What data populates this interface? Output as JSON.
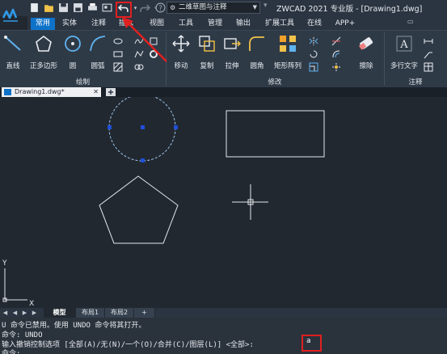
{
  "titlebar": {
    "workspace": "二维草图与注释",
    "title": "ZWCAD 2021 专业版 - [Drawing1.dwg]"
  },
  "tabs": [
    {
      "label": "常用",
      "active": true
    },
    {
      "label": "实体"
    },
    {
      "label": "注释"
    },
    {
      "label": "插入"
    },
    {
      "label": "视图"
    },
    {
      "label": "工具"
    },
    {
      "label": "管理"
    },
    {
      "label": "输出"
    },
    {
      "label": "扩展工具"
    },
    {
      "label": "在线"
    },
    {
      "label": "APP+"
    }
  ],
  "ribbon": {
    "draw": {
      "line": "直线",
      "polygon": "正多边形",
      "circle": "圆",
      "arc": "圆弧",
      "group": "绘制"
    },
    "modify": {
      "move": "移动",
      "copy": "复制",
      "stretch": "拉伸",
      "fillet": "圆角",
      "array": "矩形阵列",
      "erase": "擦除",
      "group": "修改"
    },
    "annotate": {
      "mtext": "多行文字",
      "group": "注释"
    }
  },
  "doc_tab": {
    "label": "Drawing1.dwg*"
  },
  "canvas": {
    "ucs_x": "X",
    "ucs_y": "Y"
  },
  "layout_tabs": [
    {
      "label": "模型",
      "active": true
    },
    {
      "label": "布局1"
    },
    {
      "label": "布局2"
    },
    {
      "label": "+"
    }
  ],
  "command": {
    "line1": "U 命令已禁用。使用 UNDO 命令将其打开。",
    "line2": "命令: UNDO",
    "line3": "输入撤销控制选项 [全部(A)/无(N)/一个(O)/合并(C)/图层(L)] <全部>:",
    "input": "a",
    "line4": "命令:"
  },
  "colors": {
    "accent": "#0e72c9",
    "annotation_red": "#e02020",
    "canvas_bg": "#212830"
  }
}
